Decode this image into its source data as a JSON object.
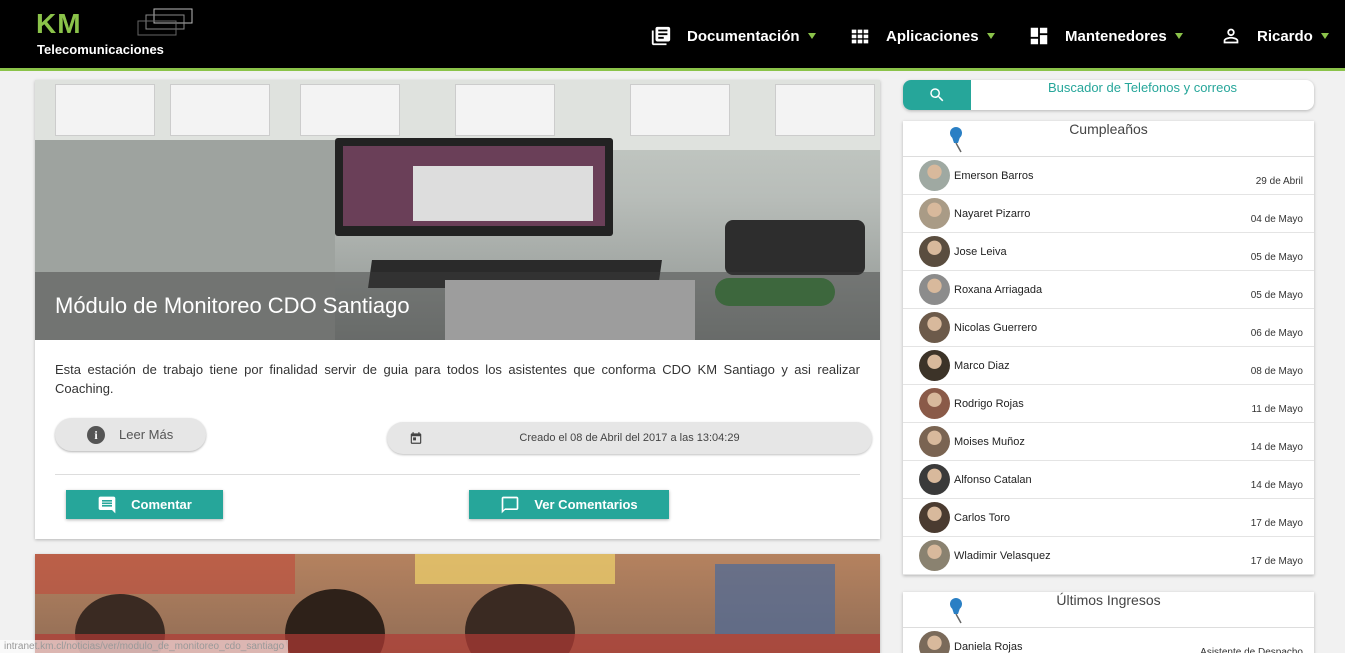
{
  "brand": {
    "line1": "KM",
    "line2": "Telecomunicaciones"
  },
  "nav": {
    "documentacion": "Documentación",
    "aplicaciones": "Aplicaciones",
    "mantenedores": "Mantenedores",
    "user": "Ricardo"
  },
  "post": {
    "title": "Módulo de Monitoreo CDO Santiago",
    "description": "Esta estación de trabajo tiene por finalidad servir de guia para todos los asistentes que conforma CDO KM Santiago y asi realizar Coaching.",
    "read_more": "Leer Más",
    "created": "Creado el 08 de Abril del 2017 a las 13:04:29",
    "comment": "Comentar",
    "view_comments": "Ver Comentarios"
  },
  "search": {
    "label": "Buscador de Telefonos y correos"
  },
  "birthdays": {
    "title": "Cumpleaños",
    "items": [
      {
        "name": "Emerson Barros",
        "date": "29 de Abril",
        "avatar_color": "#9fa9a2"
      },
      {
        "name": "Nayaret Pizarro",
        "date": "04 de Mayo",
        "avatar_color": "#a99b86"
      },
      {
        "name": "Jose Leiva",
        "date": "05 de Mayo",
        "avatar_color": "#5a4d3f"
      },
      {
        "name": "Roxana Arriagada",
        "date": "05 de Mayo",
        "avatar_color": "#8c8c8c"
      },
      {
        "name": "Nicolas Guerrero",
        "date": "06 de Mayo",
        "avatar_color": "#6c5a4a"
      },
      {
        "name": "Marco Diaz",
        "date": "08 de Mayo",
        "avatar_color": "#3c3328"
      },
      {
        "name": "Rodrigo Rojas",
        "date": "11 de Mayo",
        "avatar_color": "#8a5a48"
      },
      {
        "name": "Moises Muñoz",
        "date": "14 de Mayo",
        "avatar_color": "#7a6452"
      },
      {
        "name": "Alfonso Catalan",
        "date": "14 de Mayo",
        "avatar_color": "#3a3a3a"
      },
      {
        "name": "Carlos Toro",
        "date": "17 de Mayo",
        "avatar_color": "#4a3b30"
      },
      {
        "name": "Wladimir Velasquez",
        "date": "17 de Mayo",
        "avatar_color": "#8a8270"
      }
    ]
  },
  "latest": {
    "title": "Últimos Ingresos",
    "items": [
      {
        "name": "Daniela Rojas",
        "role": "Asistente de Despacho",
        "avatar_color": "#7a6a5a"
      }
    ]
  },
  "status_url": "intranet.km.cl/noticias/ver/modulo_de_monitoreo_cdo_santiago",
  "colors": {
    "accent": "#26a69a",
    "brand_green": "#8bc34a",
    "topbar": "#000000"
  }
}
